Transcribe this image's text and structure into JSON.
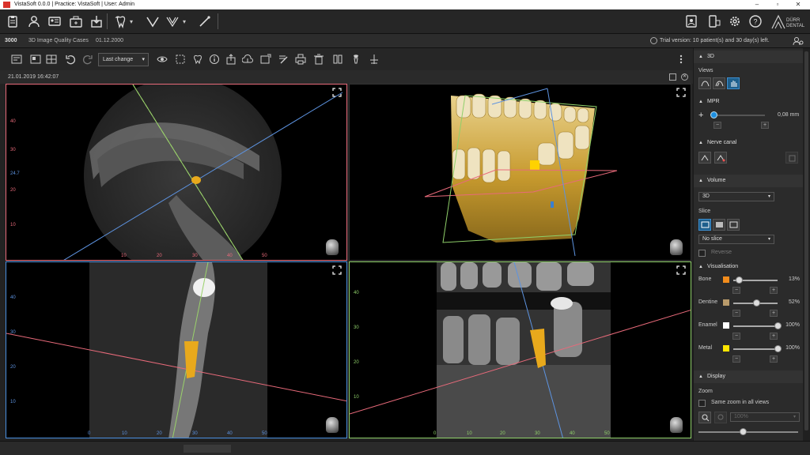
{
  "window": {
    "title": "VistaSoft 0.0.0 | Practice: VistaSoft | User: Admin"
  },
  "brand": {
    "logo_line1": "DÜRR",
    "logo_line2": "DENTAL"
  },
  "info": {
    "patient_id": "3000",
    "patient_name": "3D Image Quality Cases",
    "birth_date": "01.12.2000",
    "trial_text": "Trial version: 10 patient(s) and 30 day(s) left."
  },
  "viewer": {
    "sort_label": "Last change",
    "timestamp": "21.01.2019 16:42:07"
  },
  "views": {
    "axial": {
      "left_ticks": [
        "40",
        "30",
        "24.7",
        "20",
        "10"
      ],
      "bottom_ticks": [
        "10",
        "20",
        "30",
        "40",
        "50"
      ]
    },
    "sagittal": {
      "left_ticks": [
        "40",
        "30",
        "20",
        "10"
      ],
      "bottom_ticks": [
        "0",
        "10",
        "20",
        "30",
        "40",
        "50"
      ]
    },
    "coronal": {
      "left_ticks": [
        "40",
        "30",
        "20",
        "10"
      ],
      "bottom_ticks": [
        "0",
        "10",
        "20",
        "30",
        "40",
        "50"
      ]
    }
  },
  "panel": {
    "section_3d": "3D",
    "views_label": "Views",
    "section_mpr": "MPR",
    "mpr_value": "0,08 mm",
    "section_nerve": "Nerve canal",
    "section_volume": "Volume",
    "volume_mode": "3D",
    "slice_label": "Slice",
    "slice_mode": "No slice",
    "reverse_label": "Reverse",
    "section_visualisation": "Visualisation",
    "materials": [
      {
        "name": "Bone",
        "value": "13%",
        "level": 0.13,
        "color": "#f28c1c"
      },
      {
        "name": "Dentine",
        "value": "52%",
        "level": 0.52,
        "color": "#b99b6b"
      },
      {
        "name": "Enamel",
        "value": "100%",
        "level": 1.0,
        "color": "#ffffff"
      },
      {
        "name": "Metal",
        "value": "100%",
        "level": 1.0,
        "color": "#ffe600"
      }
    ],
    "section_display": "Display",
    "zoom_label": "Zoom",
    "same_zoom_label": "Same zoom in all views",
    "zoom_value": "100%"
  },
  "colors": {
    "accent": "#1e5f8c",
    "axial_frame": "#e86a7a",
    "sagittal_frame": "#4a8fe0",
    "coronal_frame": "#8fd06a",
    "implant": "#e8a91c"
  }
}
